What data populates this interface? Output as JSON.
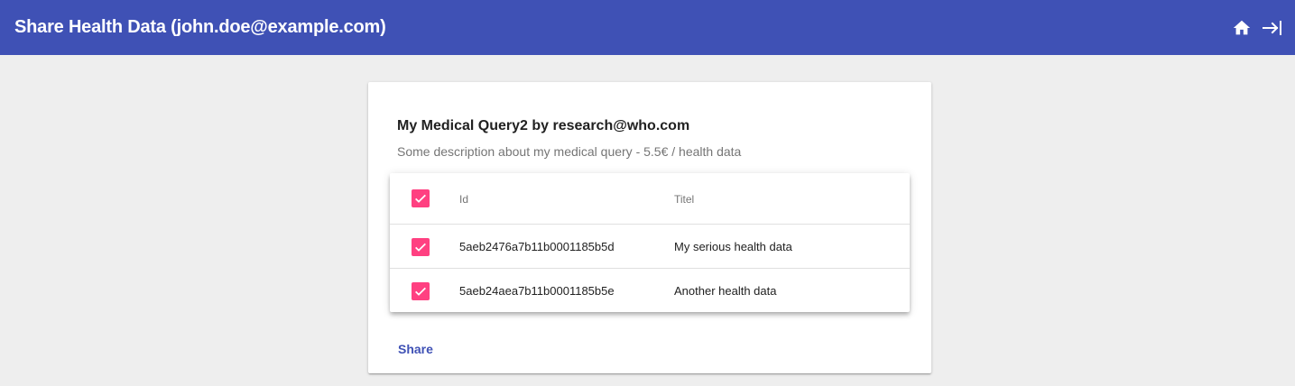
{
  "app_bar": {
    "title": "Share Health Data (john.doe@example.com)",
    "actions": [
      {
        "icon": "home-icon"
      },
      {
        "icon": "logout-icon"
      }
    ],
    "color": "#3f51b5"
  },
  "query_card": {
    "title": "My Medical Query2 by research@who.com",
    "description": "Some description about my medical query - 5.5€ / health data",
    "table": {
      "select_all_checked": true,
      "columns": [
        "Id",
        "Titel"
      ],
      "rows": [
        {
          "checked": true,
          "id": "5aeb2476a7b11b0001185b5d",
          "title": "My serious health data"
        },
        {
          "checked": true,
          "id": "5aeb24aea7b11b0001185b5e",
          "title": "Another health data"
        }
      ]
    },
    "share_label": "Share"
  },
  "colors": {
    "accent": "#ff4081",
    "primary": "#3f51b5",
    "background": "#eeeeee"
  }
}
